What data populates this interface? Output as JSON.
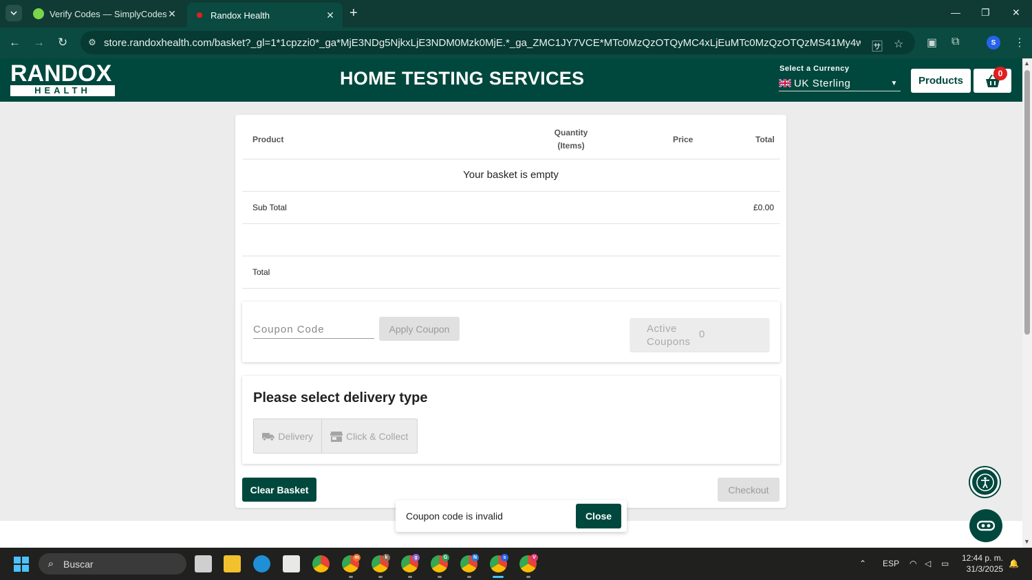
{
  "browser": {
    "tabs": [
      {
        "title": "Verify Codes — SimplyCodes",
        "active": false
      },
      {
        "title": "Randox Health",
        "active": true
      }
    ],
    "url": "store.randoxhealth.com/basket?_gl=1*1cpzzi0*_ga*MjE3NDg5NjkxLjE3NDM0Mzk0MjE.*_ga_ZMC1JY7VCE*MTc0MzQzOTQyMC4xLjEuMTc0MzQzOTQzMS41My4wLjA.*_gcl_au*MTQ2...",
    "profile_initial": "S"
  },
  "header": {
    "logo_top": "RANDOX",
    "logo_bottom": "HEALTH",
    "title": "HOME TESTING SERVICES",
    "currency_label": "Select a Currency",
    "currency_value": "UK Sterling",
    "products_label": "Products",
    "basket_count": "0"
  },
  "basket": {
    "columns": {
      "product": "Product",
      "quantity_line1": "Quantity",
      "quantity_line2": "(Items)",
      "price": "Price",
      "total": "Total"
    },
    "empty_message": "Your basket is empty",
    "subtotal_label": "Sub Total",
    "subtotal_value": "£0.00",
    "total_label": "Total"
  },
  "coupon": {
    "placeholder": "Coupon Code",
    "apply_label": "Apply Coupon",
    "active_label_line1": "Active",
    "active_label_line2": "Coupons",
    "active_count": "0"
  },
  "delivery": {
    "title": "Please select delivery type",
    "options": [
      "Delivery",
      "Click & Collect"
    ]
  },
  "actions": {
    "clear_label": "Clear Basket",
    "checkout_label": "Checkout"
  },
  "toast": {
    "message": "Coupon code is invalid",
    "close_label": "Close"
  },
  "taskbar": {
    "search_label": "Buscar",
    "language": "ESP",
    "time": "12:44 p. m.",
    "date": "31/3/2025",
    "app_badges": [
      "m",
      "k",
      "g",
      "G",
      "N",
      "s",
      "V"
    ]
  },
  "colors": {
    "brand": "#00483d",
    "badge": "#e02020",
    "chrome_dark": "#0a4a40"
  }
}
